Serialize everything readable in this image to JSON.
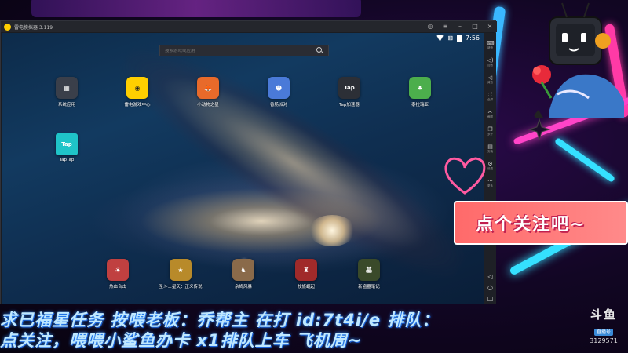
{
  "colors": {
    "accent_yellow": "#ffcf00",
    "banner_pink": "#ff7a7a",
    "ticker_blue": "#bfe8ff",
    "neon_cyan": "#35e0ff",
    "neon_pink": "#ff44c8"
  },
  "emulator": {
    "title": "雷电模拟器 3.119",
    "window_controls": [
      "gamepad-icon",
      "minimize-icon",
      "maximize-icon",
      "close-icon"
    ],
    "status": {
      "time": "7:56",
      "wifi": "wifi-icon",
      "no_sim": "no-sim-icon",
      "battery": "battery-icon"
    },
    "search": {
      "placeholder": "搜索游戏或应用"
    },
    "apps_top": [
      {
        "label": "系统应用",
        "icon": "system-apps-icon",
        "color": "#3a3f4a",
        "glyph": "▦"
      },
      {
        "label": "雷电游戏中心",
        "icon": "gamepad-icon",
        "color": "#ffcf00",
        "glyph": "◉"
      },
      {
        "label": "小动物之星",
        "icon": "fox-game-icon",
        "color": "#e86a2a",
        "glyph": "🦊"
      },
      {
        "label": "香肠派对",
        "icon": "sausage-party-icon",
        "color": "#4a7ad8",
        "glyph": "☻"
      },
      {
        "label": "Tap加速器",
        "icon": "tap-booster-icon",
        "color": "#2c2f36",
        "glyph": "Tap"
      },
      {
        "label": "泰拉瑞亚",
        "icon": "terraria-icon",
        "color": "#4cae4c",
        "glyph": "♣"
      },
      {
        "label": "TapTap",
        "icon": "taptap-icon",
        "color": "#1fc4c8",
        "glyph": "Tap"
      }
    ],
    "apps_dock": [
      {
        "label": "热血合击",
        "icon": "hot-blood-icon",
        "color": "#c04040",
        "glyph": "☀"
      },
      {
        "label": "圣斗士星矢：正义传说",
        "icon": "saint-seiya-icon",
        "color": "#b88a2a",
        "glyph": "★"
      },
      {
        "label": "余烬风暴",
        "icon": "ember-storm-icon",
        "color": "#8a6a4a",
        "glyph": "♞"
      },
      {
        "label": "校族崛起",
        "icon": "clan-rise-icon",
        "color": "#a02a2a",
        "glyph": "♜"
      },
      {
        "label": "新盗墓笔记",
        "icon": "tomb-notes-icon",
        "color": "#3a4a2a",
        "glyph": "墓"
      }
    ],
    "toolstrip": [
      {
        "label": "键盘",
        "icon": "keyboard-icon",
        "glyph": "⌨"
      },
      {
        "label": "加音",
        "icon": "volume-up-icon",
        "glyph": "◁)"
      },
      {
        "label": "减音",
        "icon": "volume-down-icon",
        "glyph": "◁"
      },
      {
        "label": "全屏",
        "icon": "fullscreen-icon",
        "glyph": "⛶"
      },
      {
        "label": "截图",
        "icon": "scissors-icon",
        "glyph": "✂"
      },
      {
        "label": "多开",
        "icon": "multi-instance-icon",
        "glyph": "❐"
      },
      {
        "label": "安装",
        "icon": "install-apk-icon",
        "glyph": "▤"
      },
      {
        "label": "设置",
        "icon": "gear-icon",
        "glyph": "⚙"
      },
      {
        "label": "更多",
        "icon": "more-icon",
        "glyph": "···"
      }
    ],
    "nav_buttons": [
      "back-icon",
      "home-icon",
      "recents-icon"
    ]
  },
  "overlay": {
    "banner": "点个关注吧~",
    "ticker_line1": "求已福星任务 按喂老板：乔帮主 在打 id:7t4i/e 排队：",
    "ticker_line2": "点关注，喂喂小鲨鱼办卡 x1排队上车 飞机周~",
    "douyu_logo": "斗鱼",
    "douyu_tag": "直播号",
    "room_id": "3129571"
  }
}
